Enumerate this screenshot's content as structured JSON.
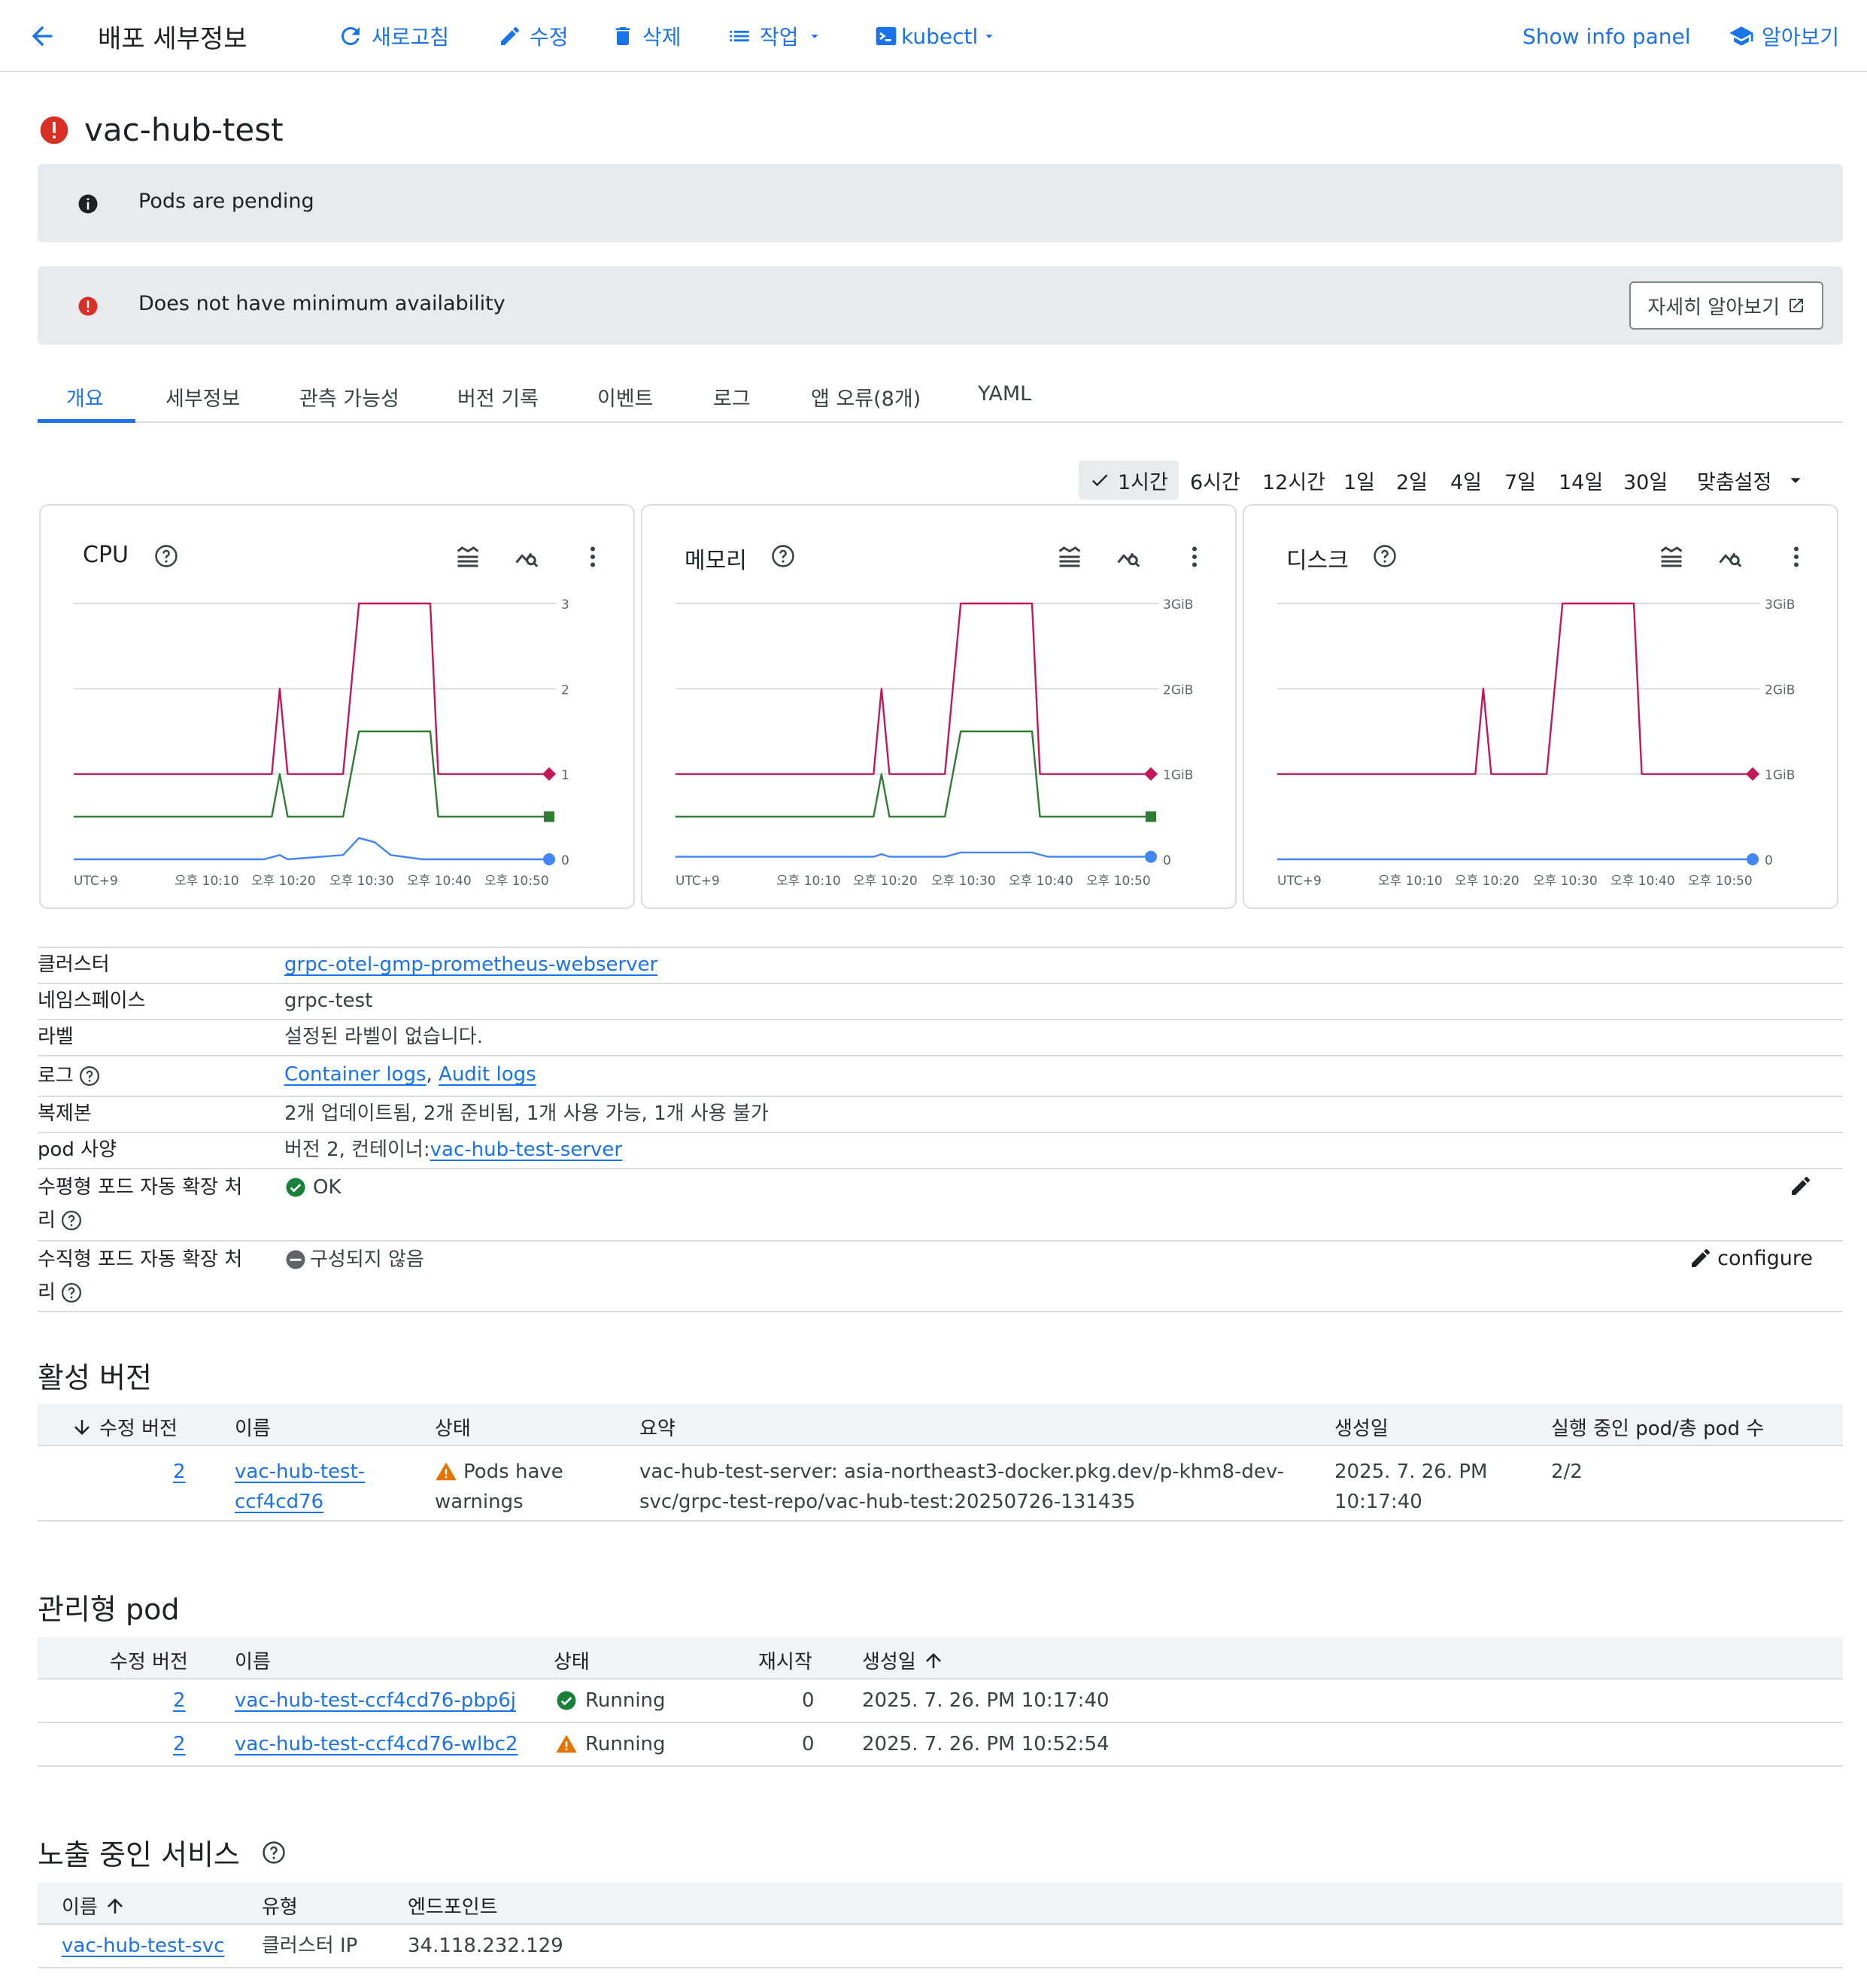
{
  "toolbar": {
    "heading": "배포 세부정보",
    "refresh": "새로고침",
    "edit": "수정",
    "delete": "삭제",
    "actions": "작업",
    "kubectl": "kubectl",
    "info_panel": "Show info panel",
    "learn": "알아보기"
  },
  "title": "vac-hub-test",
  "banners": {
    "info": "Pods are pending",
    "error": "Does not have minimum availability",
    "learn_more": "자세히 알아보기"
  },
  "tabs": [
    "개요",
    "세부정보",
    "관측 가능성",
    "버전 기록",
    "이벤트",
    "로그",
    "앱 오류(8개)",
    "YAML"
  ],
  "time_range": {
    "options": [
      "1시간",
      "6시간",
      "12시간",
      "1일",
      "2일",
      "4일",
      "7일",
      "14일",
      "30일"
    ],
    "selected": "1시간",
    "custom": "맞춤설정"
  },
  "colors": {
    "accent": "#1a73e8",
    "error": "#d93025",
    "warning": "#e37400",
    "success": "#188038",
    "limit_series": "#c2185b",
    "request_series": "#2e7d32",
    "usage_series": "#4285f4"
  },
  "chart_data": [
    {
      "type": "line",
      "title": "CPU",
      "x": [
        "UTC+9",
        "오후 10:10",
        "오후 10:20",
        "오후 10:30",
        "오후 10:40",
        "오후 10:50"
      ],
      "yticks": [
        "0",
        "1",
        "2",
        "3"
      ],
      "ylim": [
        0,
        3
      ],
      "series": [
        {
          "color": "#c2185b",
          "points": [
            [
              0,
              1
            ],
            [
              25,
              1
            ],
            [
              26,
              2
            ],
            [
              27,
              1
            ],
            [
              34,
              1
            ],
            [
              36,
              3
            ],
            [
              45,
              3
            ],
            [
              46,
              1
            ],
            [
              60,
              1
            ]
          ]
        },
        {
          "color": "#2e7d32",
          "points": [
            [
              0,
              0.5
            ],
            [
              25,
              0.5
            ],
            [
              26,
              1
            ],
            [
              27,
              0.5
            ],
            [
              34,
              0.5
            ],
            [
              36,
              1.5
            ],
            [
              45,
              1.5
            ],
            [
              46,
              0.5
            ],
            [
              60,
              0.5
            ]
          ]
        },
        {
          "color": "#4285f4",
          "points": [
            [
              0,
              0
            ],
            [
              24,
              0
            ],
            [
              26,
              0.05
            ],
            [
              27,
              0
            ],
            [
              34,
              0.05
            ],
            [
              36,
              0.25
            ],
            [
              38,
              0.2
            ],
            [
              40,
              0.05
            ],
            [
              44,
              0
            ],
            [
              60,
              0
            ]
          ]
        }
      ]
    },
    {
      "type": "line",
      "title": "메모리",
      "x": [
        "UTC+9",
        "오후 10:10",
        "오후 10:20",
        "오후 10:30",
        "오후 10:40",
        "오후 10:50"
      ],
      "yticks": [
        "0",
        "1GiB",
        "2GiB",
        "3GiB"
      ],
      "ylim": [
        0,
        3
      ],
      "series": [
        {
          "color": "#c2185b",
          "points": [
            [
              0,
              1
            ],
            [
              25,
              1
            ],
            [
              26,
              2
            ],
            [
              27,
              1
            ],
            [
              34,
              1
            ],
            [
              36,
              3
            ],
            [
              45,
              3
            ],
            [
              46,
              1
            ],
            [
              60,
              1
            ]
          ]
        },
        {
          "color": "#2e7d32",
          "points": [
            [
              0,
              0.5
            ],
            [
              25,
              0.5
            ],
            [
              26,
              1
            ],
            [
              27,
              0.5
            ],
            [
              34,
              0.5
            ],
            [
              36,
              1.5
            ],
            [
              45,
              1.5
            ],
            [
              46,
              0.5
            ],
            [
              60,
              0.5
            ]
          ]
        },
        {
          "color": "#4285f4",
          "points": [
            [
              0,
              0.03
            ],
            [
              25,
              0.03
            ],
            [
              26,
              0.06
            ],
            [
              27,
              0.03
            ],
            [
              34,
              0.03
            ],
            [
              36,
              0.08
            ],
            [
              45,
              0.08
            ],
            [
              47,
              0.03
            ],
            [
              60,
              0.03
            ]
          ]
        }
      ]
    },
    {
      "type": "line",
      "title": "디스크",
      "x": [
        "UTC+9",
        "오후 10:10",
        "오후 10:20",
        "오후 10:30",
        "오후 10:40",
        "오후 10:50"
      ],
      "yticks": [
        "0",
        "1GiB",
        "2GiB",
        "3GiB"
      ],
      "ylim": [
        0,
        3
      ],
      "series": [
        {
          "color": "#c2185b",
          "points": [
            [
              0,
              1
            ],
            [
              25,
              1
            ],
            [
              26,
              2
            ],
            [
              27,
              1
            ],
            [
              34,
              1
            ],
            [
              36,
              3
            ],
            [
              45,
              3
            ],
            [
              46,
              1
            ],
            [
              60,
              1
            ]
          ]
        },
        {
          "color": "#4285f4",
          "points": [
            [
              0,
              0
            ],
            [
              60,
              0
            ]
          ]
        }
      ]
    }
  ],
  "details": {
    "cluster_label": "클러스터",
    "cluster_value": "grpc-otel-gmp-prometheus-webserver",
    "namespace_label": "네임스페이스",
    "namespace_value": "grpc-test",
    "labels_label": "라벨",
    "labels_value": "설정된 라벨이 없습니다.",
    "logs_label": "로그",
    "logs_container": "Container logs",
    "logs_sep": ",",
    "logs_audit": "Audit logs",
    "replicas_label": "복제본",
    "replicas_value": "2개 업데이트됨, 2개 준비됨, 1개 사용 가능, 1개 사용 불가",
    "podspec_label": "pod 사양",
    "podspec_prefix": "버전 2, 컨테이너:",
    "podspec_container": "vac-hub-test-server",
    "hpa_label_1": "수평형 포드 자동 확장 처",
    "hpa_label_2": "리",
    "hpa_value": "OK",
    "vpa_label_1": "수직형 포드 자동 확장 처",
    "vpa_label_2": "리",
    "vpa_value": "구성되지 않음",
    "vpa_action": "configure"
  },
  "revisions": {
    "title": "활성 버전",
    "headers": [
      "수정 버전",
      "이름",
      "상태",
      "요약",
      "생성일",
      "실행 중인 pod/총 pod 수"
    ],
    "rows": [
      {
        "revision": "2",
        "name_1": "vac-hub-test-",
        "name_2": "ccf4cd76",
        "status_1": "Pods have",
        "status_2": "warnings",
        "summary_1": "vac-hub-test-server: asia-northeast3-docker.pkg.dev/p-khm8-dev-",
        "summary_2": "svc/grpc-test-repo/vac-hub-test:20250726-131435",
        "created_1": "2025. 7. 26. PM",
        "created_2": "10:17:40",
        "pods": "2/2"
      }
    ]
  },
  "pods": {
    "title": "관리형 pod",
    "headers": [
      "수정 버전",
      "이름",
      "상태",
      "재시작",
      "생성일"
    ],
    "rows": [
      {
        "revision": "2",
        "name": "vac-hub-test-ccf4cd76-pbp6j",
        "status": "Running",
        "restarts": "0",
        "created": "2025. 7. 26. PM 10:17:40"
      },
      {
        "revision": "2",
        "name": "vac-hub-test-ccf4cd76-wlbc2",
        "status": "Running",
        "restarts": "0",
        "created": "2025. 7. 26. PM 10:52:54"
      }
    ]
  },
  "services": {
    "title": "노출 중인 서비스",
    "headers": [
      "이름",
      "유형",
      "엔드포인트"
    ],
    "rows": [
      {
        "name": "vac-hub-test-svc",
        "type": "클러스터 IP",
        "endpoint": "34.118.232.129"
      }
    ]
  }
}
